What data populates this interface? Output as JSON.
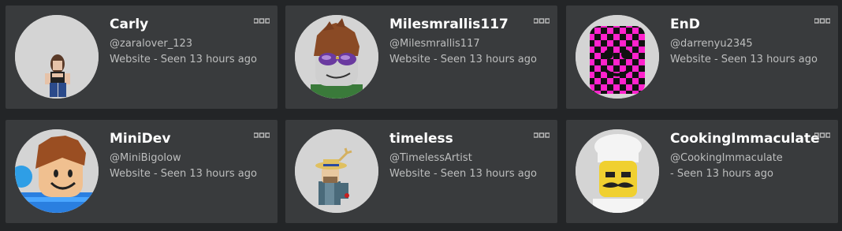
{
  "friends": [
    {
      "display_name": "Carly",
      "username": "@zaralover_123",
      "status": "Website - Seen 13 hours ago",
      "avatar_icon": "avatar-carly-icon"
    },
    {
      "display_name": "Milesmrallis117",
      "username": "@Milesmrallis117",
      "status": "Website - Seen 13 hours ago",
      "avatar_icon": "avatar-milesmrallis117-icon"
    },
    {
      "display_name": "EnD",
      "username": "@darrenyu2345",
      "status": "Website - Seen 13 hours ago",
      "avatar_icon": "avatar-end-icon"
    },
    {
      "display_name": "MiniDev",
      "username": "@MiniBigolow",
      "status": "Website - Seen 13 hours ago",
      "avatar_icon": "avatar-minidev-icon"
    },
    {
      "display_name": "timeless",
      "username": "@TimelessArtist",
      "status": "Website - Seen 13 hours ago",
      "avatar_icon": "avatar-timeless-icon"
    },
    {
      "display_name": "CookingImmaculate",
      "username": "@CookingImmaculate",
      "status": "- Seen 13 hours ago",
      "avatar_icon": "avatar-cookingimmaculate-icon"
    }
  ],
  "more_icon": "more-options-icon",
  "colors": {
    "background": "#232527",
    "card": "#393b3d",
    "name_text": "#ffffff",
    "secondary_text": "#bdbebe"
  }
}
